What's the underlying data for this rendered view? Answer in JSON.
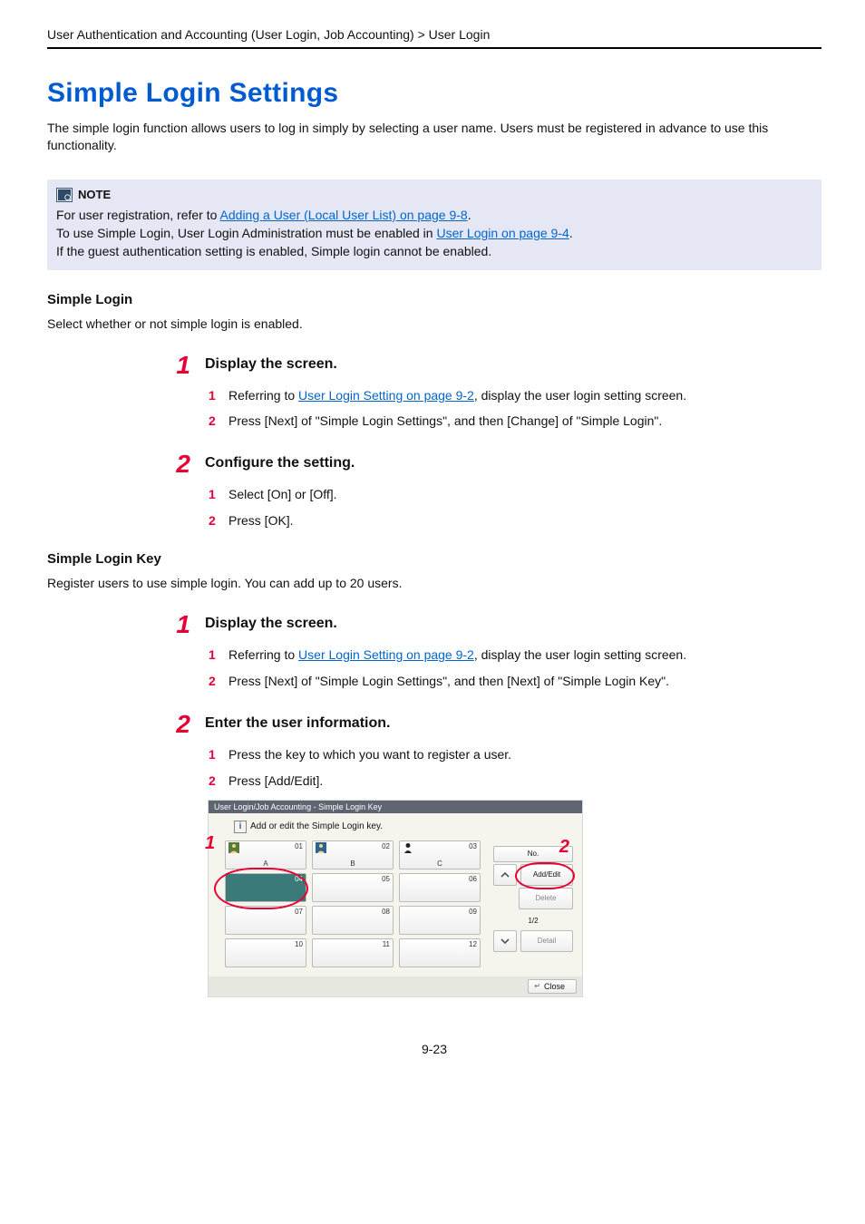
{
  "breadcrumb": "User Authentication and Accounting (User Login, Job Accounting) > User Login",
  "title": "Simple Login Settings",
  "intro": "The simple login function allows users to log in simply by selecting a user name. Users must be registered in advance to use this functionality.",
  "note": {
    "label": "NOTE",
    "line1_pre": "For user registration, refer to ",
    "line1_link": "Adding a User (Local User List) on page 9-8",
    "line1_post": ".",
    "line2_pre": "To use Simple Login, User Login Administration must be enabled in ",
    "line2_link": "User Login on page 9-4",
    "line2_post": ".",
    "line3": "If the guest authentication setting is enabled, Simple login cannot be enabled."
  },
  "section1": {
    "heading": "Simple Login",
    "desc": "Select whether or not simple login is enabled.",
    "step1_title": "Display the screen.",
    "step1_sub1_pre": "Referring to ",
    "step1_sub1_link": "User Login Setting on page 9-2",
    "step1_sub1_post": ", display the user login setting screen.",
    "step1_sub2": "Press [Next] of \"Simple Login Settings\", and then [Change] of \"Simple Login\".",
    "step2_title": "Configure the setting.",
    "step2_sub1": "Select [On] or [Off].",
    "step2_sub2": "Press [OK]."
  },
  "section2": {
    "heading": "Simple Login Key",
    "desc": "Register users to use simple login. You can add up to 20 users.",
    "step1_title": "Display the screen.",
    "step1_sub1_pre": "Referring to ",
    "step1_sub1_link": "User Login Setting on page 9-2",
    "step1_sub1_post": ", display the user login setting screen.",
    "step1_sub2": "Press [Next] of \"Simple Login Settings\", and then [Next] of \"Simple Login Key\".",
    "step2_title": "Enter the user information.",
    "step2_sub1": "Press the key to which you want to register a user.",
    "step2_sub2": "Press [Add/Edit]."
  },
  "screenshot": {
    "title": "User Login/Job Accounting - Simple Login Key",
    "hint": "Add or edit the Simple Login key.",
    "keys": {
      "k01n": "01",
      "k01l": "A",
      "k02n": "02",
      "k02l": "B",
      "k03n": "03",
      "k03l": "C",
      "k04n": "04",
      "k05n": "05",
      "k06n": "06",
      "k07n": "07",
      "k08n": "08",
      "k09n": "09",
      "k10n": "10",
      "k11n": "11",
      "k12n": "12"
    },
    "no_label": "No.",
    "add_edit": "Add/Edit",
    "delete": "Delete",
    "detail": "Detail",
    "page": "1/2",
    "close": "Close",
    "callout1": "1",
    "callout2": "2"
  },
  "pageno": "9-23"
}
